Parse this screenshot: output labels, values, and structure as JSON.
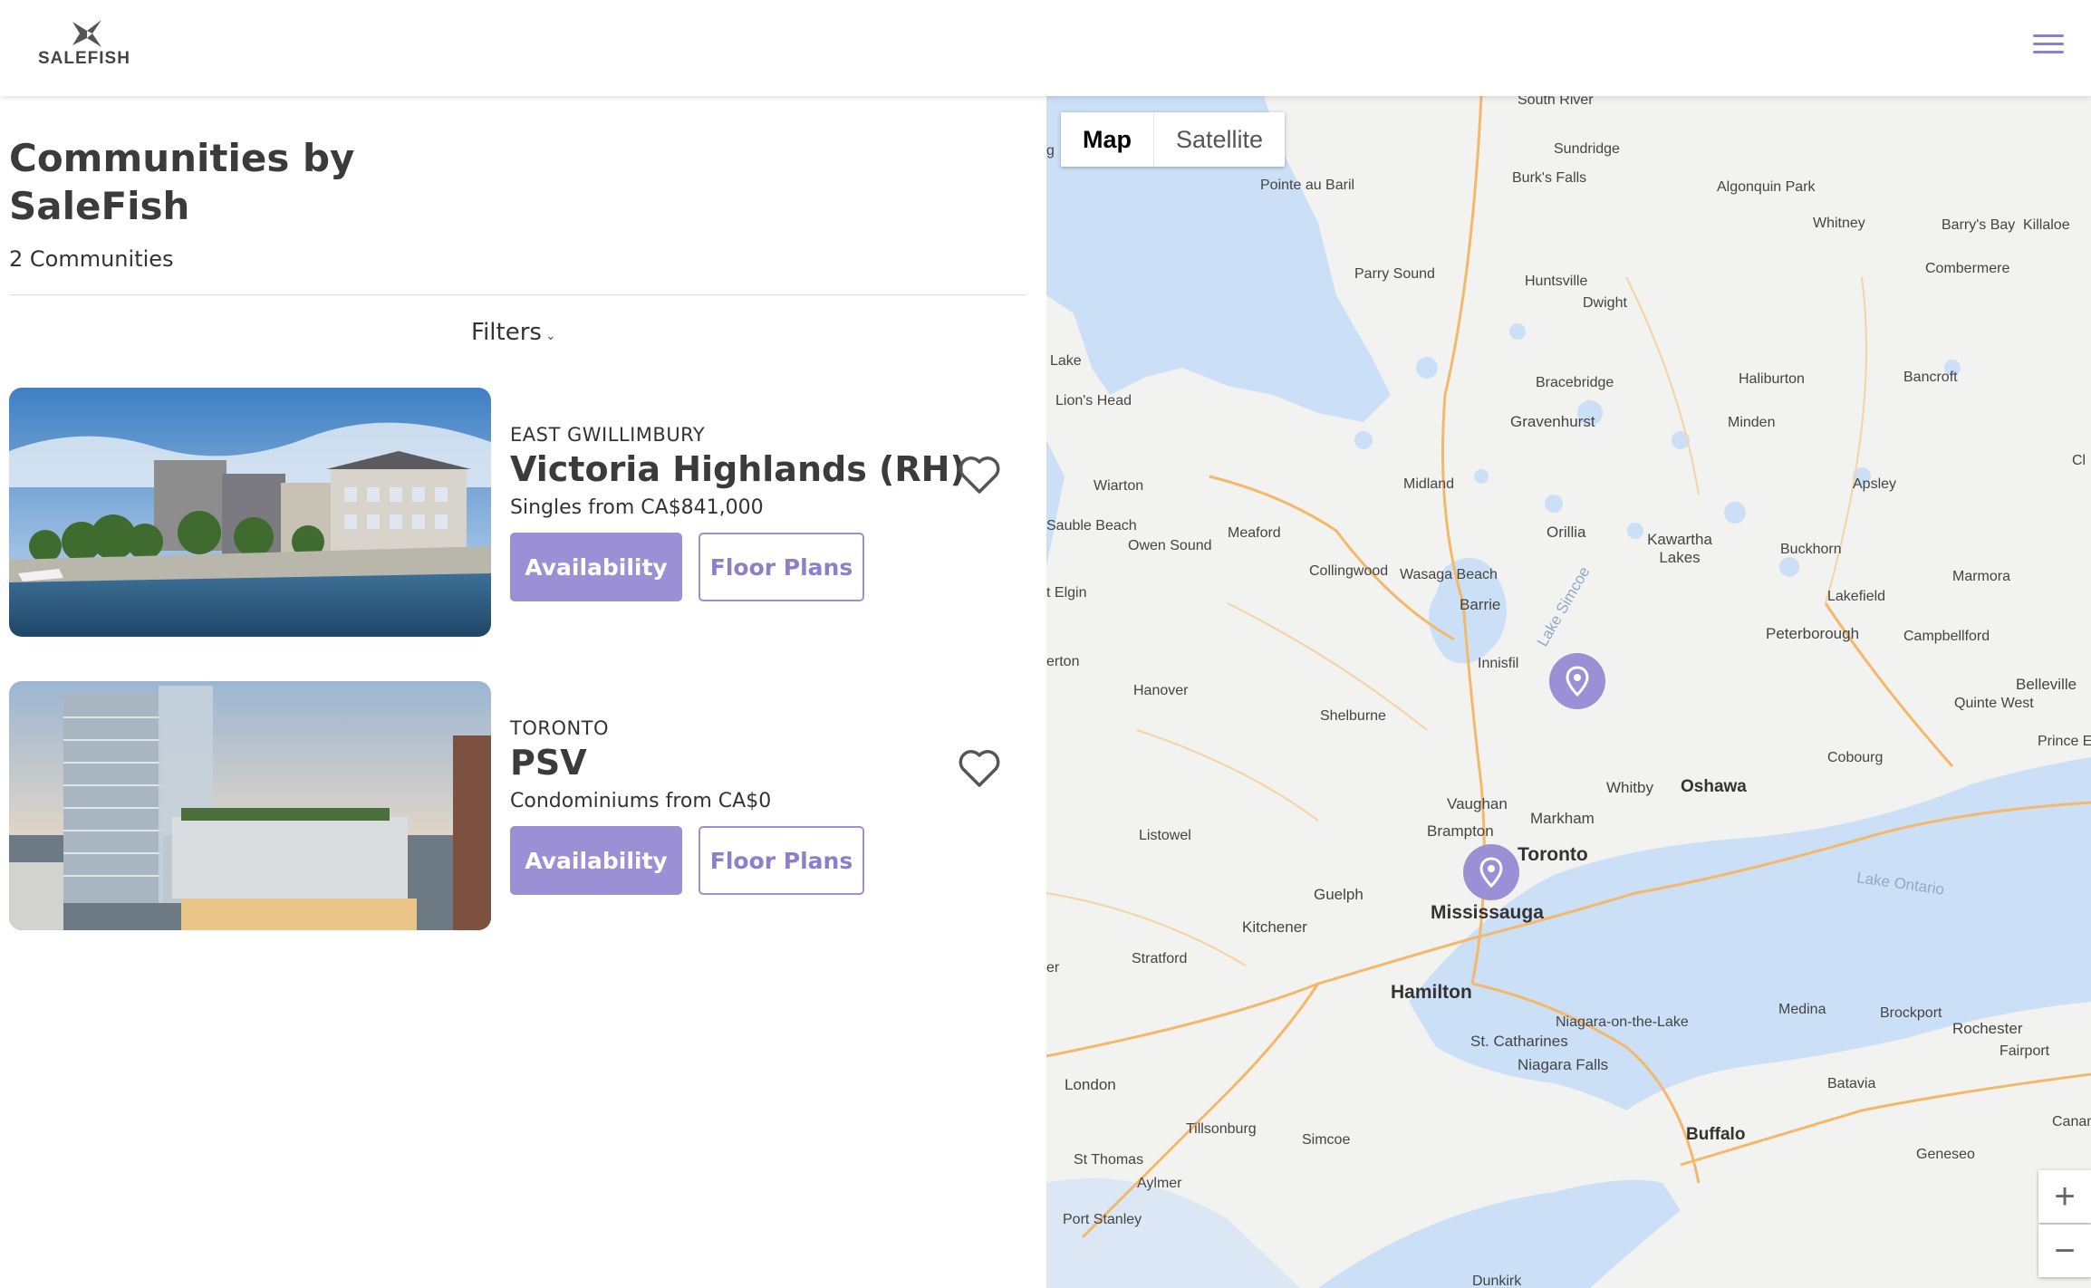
{
  "header": {
    "logo_text": "SALEFISH",
    "menu_icon": "hamburger-menu-icon"
  },
  "page": {
    "title": "Communities by SaleFish",
    "count": "2 Communities",
    "filters_label": "Filters"
  },
  "communities": [
    {
      "region": "EAST GWILLIMBURY",
      "name": "Victoria Highlands (RH)",
      "price": "Singles from CA$841,000",
      "availability_label": "Availability",
      "floorplans_label": "Floor Plans"
    },
    {
      "region": "TORONTO",
      "name": "PSV",
      "price": "Condominiums from CA$0",
      "availability_label": "Availability",
      "floorplans_label": "Floor Plans"
    }
  ],
  "map": {
    "map_type": {
      "map_label": "Map",
      "satellite_label": "Satellite",
      "selected": "Map"
    },
    "zoom_in": "+",
    "zoom_out": "−",
    "labels": {
      "south_river": "South River",
      "sundridge": "Sundridge",
      "burks_falls": "Burk's Falls",
      "pointe_au_baril": "Pointe au Baril",
      "algonquin_park": "Algonquin Park",
      "whitney": "Whitney",
      "barrys_bay": "Barry's Bay",
      "killaloe": "Killaloe",
      "parry_sound": "Parry Sound",
      "huntsville": "Huntsville",
      "dwight": "Dwight",
      "combermere": "Combermere",
      "lake": "Lake",
      "lions_head": "Lion's Head",
      "bracebridge": "Bracebridge",
      "haliburton": "Haliburton",
      "bancroft": "Bancroft",
      "gravenhurst": "Gravenhurst",
      "minden": "Minden",
      "wiarton": "Wiarton",
      "midland": "Midland",
      "apsley": "Apsley",
      "sauble_beach": "Sauble Beach",
      "meaford": "Meaford",
      "owen_sound": "Owen Sound",
      "orillia": "Orillia",
      "kawartha_lakes": "Kawartha Lakes",
      "buckhorn": "Buckhorn",
      "collingwood": "Collingwood",
      "wasaga_beach": "Wasaga Beach",
      "marmora": "Marmora",
      "port_elgin": "t Elgin",
      "lakefield": "Lakefield",
      "barrie": "Barrie",
      "lake_simcoe": "Lake Simcoe",
      "peterborough": "Peterborough",
      "campbellford": "Campbellford",
      "kincardine": "erton",
      "innisfil": "Innisfil",
      "hanover": "Hanover",
      "belleville": "Belleville",
      "quinte_west": "Quinte West",
      "shelburne": "Shelburne",
      "prince_edward": "Prince E",
      "cobourg": "Cobourg",
      "whitby": "Whitby",
      "oshawa": "Oshawa",
      "vaughan": "Vaughan",
      "markham": "Markham",
      "brampton": "Brampton",
      "toronto": "Toronto",
      "listowel": "Listowel",
      "lake_ontario": "Lake Ontario",
      "guelph": "Guelph",
      "mississauga": "Mississauga",
      "kitchener": "Kitchener",
      "stratford": "Stratford",
      "goderich": "er",
      "hamilton": "Hamilton",
      "niagara_on_the_lake": "Niagara-on-the-Lake",
      "medina": "Medina",
      "brockport": "Brockport",
      "rochester": "Rochester",
      "st_catharines": "St. Catharines",
      "fairport": "Fairport",
      "niagara_falls": "Niagara Falls",
      "london": "London",
      "batavia": "Batavia",
      "canandaigua": "Canand",
      "tillsonburg": "Tillsonburg",
      "simcoe": "Simcoe",
      "buffalo": "Buffalo",
      "st_thomas": "St Thomas",
      "aylmer": "Aylmer",
      "geneseo": "Geneseo",
      "port_stanley": "Port Stanley",
      "dunkirk": "Dunkirk",
      "cl": "Cl",
      "g": "g"
    }
  }
}
